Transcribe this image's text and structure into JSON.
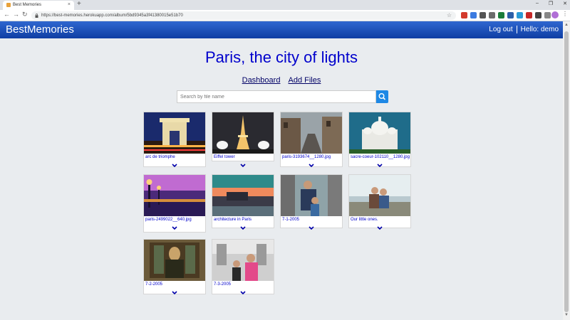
{
  "browser": {
    "tab_title": "Best Memories",
    "tab_close": "×",
    "new_tab": "+",
    "url": "https://best-memories.herokuapp.com/album/5bd9345a3f41380015e51b70",
    "nav": {
      "back": "←",
      "forward": "→",
      "reload": "↻"
    },
    "window_controls": [
      "–",
      "❐",
      "✕"
    ],
    "star": "☆",
    "menu": "⋮",
    "extension_colors": [
      "#d33a2c",
      "#3c7be0",
      "#555555",
      "#6c6c6c",
      "#1b7d3a",
      "#2c5fa8",
      "#2a9bd7",
      "#c62828",
      "#444444",
      "#888888"
    ]
  },
  "header": {
    "brand": "BestMemories",
    "logout": "Log out",
    "greeting": "Hello: demo",
    "gradient": [
      "#2f67d0",
      "#0f3ea3"
    ]
  },
  "album": {
    "title": "Paris, the city of lights"
  },
  "links": {
    "dashboard": "Dashboard",
    "add_files": "Add Files"
  },
  "search": {
    "placeholder": "Search by file name",
    "icon": "search-icon"
  },
  "photos": [
    {
      "caption": "arc de triomphe",
      "scene": "arc"
    },
    {
      "caption": "Eiffel tower",
      "scene": "eiffel"
    },
    {
      "caption": "paris-3193674__1280.jpg",
      "scene": "street"
    },
    {
      "caption": "sacre-coeur-102110__1280.jpg",
      "scene": "sacre"
    },
    {
      "caption": "paris-2499022__640.jpg",
      "scene": "bridge"
    },
    {
      "caption": "architecture in Paris",
      "scene": "sunset"
    },
    {
      "caption": "7-1-2005",
      "scene": "dad"
    },
    {
      "caption": "Our little ones.",
      "scene": "kids"
    },
    {
      "caption": "7-2-2005",
      "scene": "mona"
    },
    {
      "caption": "7-3-2005",
      "scene": "girls"
    }
  ]
}
